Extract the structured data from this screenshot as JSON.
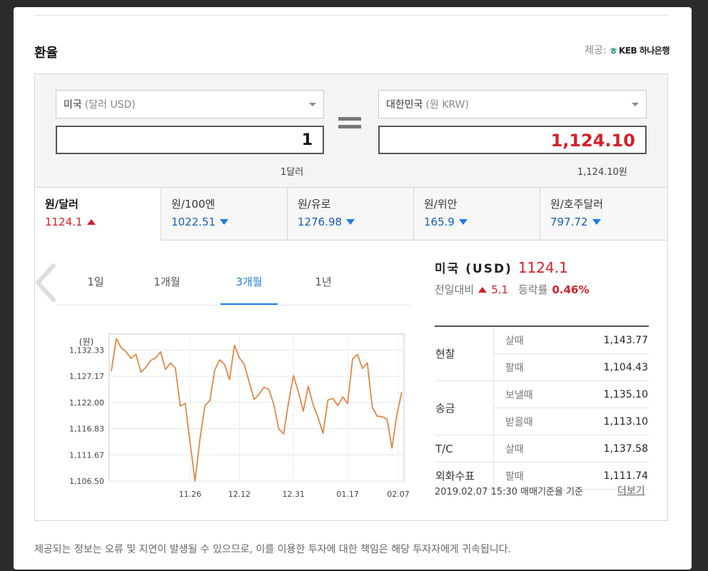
{
  "header": {
    "title": "환율",
    "provider_label": "제공:",
    "provider_name": "KEB 하나은행",
    "provider_mark": "ㅎ"
  },
  "converter": {
    "from_country": "미국",
    "from_unit": "(달러 USD)",
    "from_amount": "1",
    "from_caption": "1달러",
    "to_country": "대한민국",
    "to_unit": "(원 KRW)",
    "to_amount": "1,124.10",
    "to_caption": "1,124.10원"
  },
  "tabs": [
    {
      "label": "원/달러",
      "value": "1124.1",
      "dir": "up"
    },
    {
      "label": "원/100엔",
      "value": "1022.51",
      "dir": "down"
    },
    {
      "label": "원/유로",
      "value": "1276.98",
      "dir": "down"
    },
    {
      "label": "원/위안",
      "value": "165.9",
      "dir": "down"
    },
    {
      "label": "원/호주달러",
      "value": "797.72",
      "dir": "down"
    }
  ],
  "periods": [
    "1일",
    "1개월",
    "3개월",
    "1년"
  ],
  "active_period": "3개월",
  "summary": {
    "currency": "미국 (USD)",
    "rate": "1124.1",
    "change_label": "전일대비",
    "change": "5.1",
    "ratio_label": "등락률",
    "ratio": "0.46%"
  },
  "rates_table": [
    {
      "category": "현찰",
      "rows": [
        {
          "type": "살때",
          "value": "1,143.77"
        },
        {
          "type": "팔때",
          "value": "1,104.43"
        }
      ]
    },
    {
      "category": "송금",
      "rows": [
        {
          "type": "보낼때",
          "value": "1,135.10"
        },
        {
          "type": "받을때",
          "value": "1,113.10"
        }
      ]
    },
    {
      "category": "T/C",
      "rows": [
        {
          "type": "살때",
          "value": "1,137.58"
        }
      ]
    },
    {
      "category": "외화수표",
      "rows": [
        {
          "type": "팔때",
          "value": "1,111.74"
        }
      ]
    }
  ],
  "timestamp": "2019.02.07 15:30 매매기준율 기준",
  "more_link": "더보기",
  "disclaimer": "제공되는 정보는 오류 및 지연이 발생될 수 있으므로, 이를 이용한 투자에 대한 책임은 해당 투자자에게 귀속됩니다.",
  "colors": {
    "line": "#e0884a",
    "up": "#d3202a",
    "down": "#1a7ee0",
    "accent": "#1a7ee0"
  },
  "chart_data": {
    "type": "line",
    "ylabel": "(원)",
    "yticks": [
      "1,132.33",
      "1,127.17",
      "1,122.00",
      "1,116.83",
      "1,111.67",
      "1,106.50"
    ],
    "xticks": [
      "11.26",
      "12.12",
      "12.31",
      "01.17",
      "02.07"
    ],
    "ylim": [
      1106.5,
      1135.5
    ],
    "grid": true,
    "values": [
      1128.2,
      1134.6,
      1132.8,
      1132.0,
      1130.7,
      1131.5,
      1128.0,
      1128.9,
      1130.3,
      1130.8,
      1132.0,
      1128.5,
      1129.8,
      1128.8,
      1121.3,
      1121.8,
      1114.0,
      1106.5,
      1114.8,
      1121.4,
      1122.4,
      1128.4,
      1130.4,
      1129.5,
      1126.5,
      1133.3,
      1130.8,
      1129.5,
      1126.0,
      1122.6,
      1123.6,
      1125.0,
      1124.6,
      1121.6,
      1116.8,
      1115.8,
      1122.0,
      1127.3,
      1124.1,
      1120.3,
      1125.2,
      1121.5,
      1119.0,
      1115.9,
      1122.5,
      1122.8,
      1121.4,
      1123.1,
      1121.8,
      1130.6,
      1131.5,
      1128.7,
      1129.8,
      1121.1,
      1119.3,
      1119.2,
      1118.7,
      1113.0,
      1119.6,
      1124.1
    ]
  }
}
